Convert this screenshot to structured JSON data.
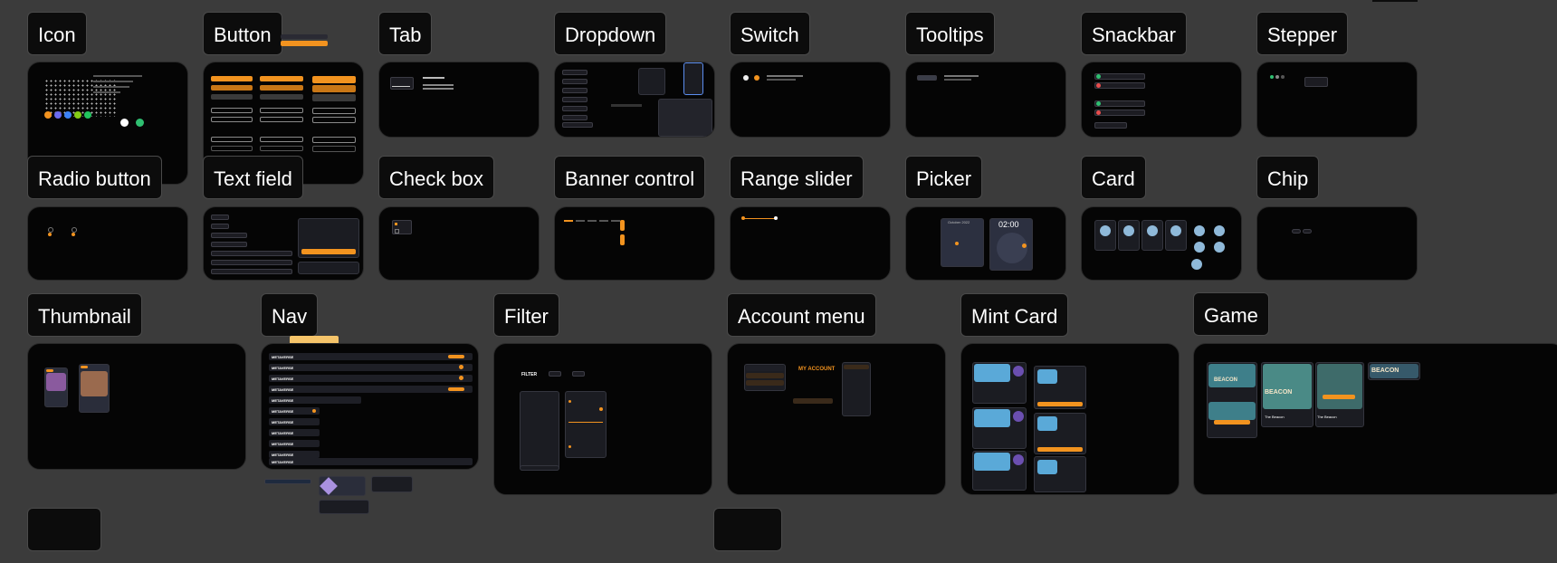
{
  "sections": {
    "icon": "Icon",
    "button": "Button",
    "tab": "Tab",
    "dropdown": "Dropdown",
    "switch": "Switch",
    "tooltips": "Tooltips",
    "snackbar": "Snackbar",
    "stepper": "Stepper",
    "radio_button": "Radio button",
    "text_field": "Text field",
    "check_box": "Check box",
    "banner_control": "Banner control",
    "range_slider": "Range slider",
    "picker": "Picker",
    "card": "Card",
    "chip": "Chip",
    "thumbnail": "Thumbnail",
    "nav": "Nav",
    "filter": "Filter",
    "account_menu": "Account menu",
    "mint_card": "Mint Card",
    "game": "Game"
  },
  "details": {
    "button_labels": "CALL TO ACTION",
    "brand": "METAVERSE",
    "filter_title": "FILTER",
    "account_title": "MY ACCOUNT",
    "picker_month": "October 2022",
    "picker_time": "02:00",
    "game_title": "BEACON",
    "game_name": "The Beacon"
  },
  "colors": {
    "accent": "#f2931f",
    "canvas": "#3b3b3b",
    "card": "#050505",
    "label_bg": "#0c0c0c"
  }
}
